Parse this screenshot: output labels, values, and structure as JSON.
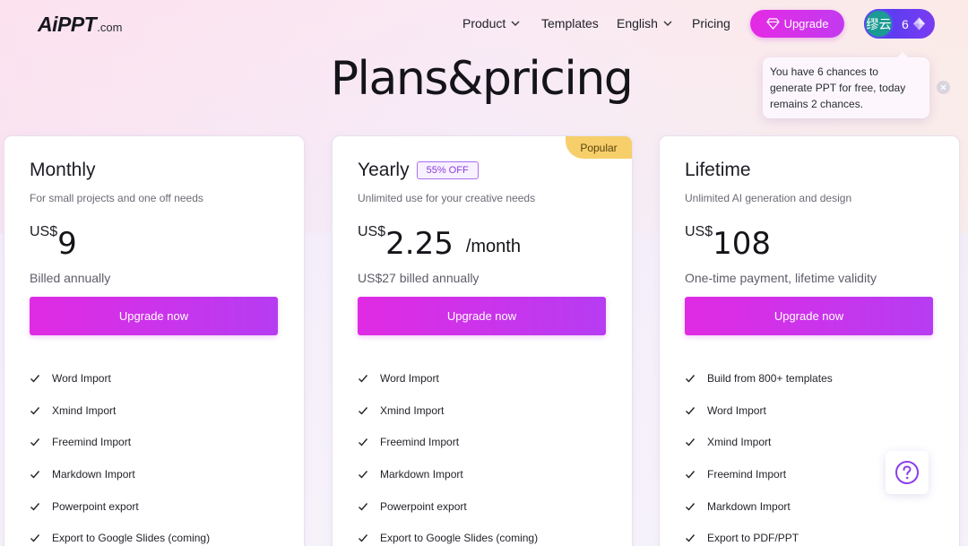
{
  "logo": {
    "main": "AiPPT",
    "sub": ".com"
  },
  "nav": {
    "product": "Product",
    "templates": "Templates",
    "language": "English",
    "pricing": "Pricing"
  },
  "header": {
    "upgrade_label": "Upgrade",
    "avatar_text": "缪云",
    "credits": "6"
  },
  "tooltip": {
    "text": "You have 6 chances to generate PPT for free, today remains 2 chances."
  },
  "page": {
    "title": "Plans&pricing"
  },
  "plans": [
    {
      "name": "Monthly",
      "description": "For small projects and one off needs",
      "currency": "US$",
      "amount": "9",
      "period": "",
      "billing": "Billed annually",
      "cta": "Upgrade now",
      "features": [
        "Word Import",
        "Xmind Import",
        "Freemind Import",
        "Markdown Import",
        "Powerpoint export",
        "Export to Google Slides (coming)"
      ]
    },
    {
      "name": "Yearly",
      "badge": "55% OFF",
      "ribbon": "Popular",
      "description": "Unlimited use for your creative needs",
      "currency": "US$",
      "amount": "2.25",
      "period": "/month",
      "billing": "US$27 billed annually",
      "cta": "Upgrade now",
      "features": [
        "Word Import",
        "Xmind Import",
        "Freemind Import",
        "Markdown Import",
        "Powerpoint export",
        "Export to Google Slides (coming)"
      ]
    },
    {
      "name": "Lifetime",
      "description": "Unlimited AI generation and design",
      "currency": "US$",
      "amount": "108",
      "period": "",
      "billing": "One-time payment, lifetime validity",
      "cta": "Upgrade now",
      "features": [
        "Build from 800+ templates",
        "Word Import",
        "Xmind Import",
        "Freemind Import",
        "Markdown Import",
        "Export to PDF/PPT"
      ]
    }
  ],
  "icons": {
    "chevron": "chevron-down-icon",
    "diamond": "diamond-icon",
    "check": "check-icon",
    "close": "close-icon",
    "help": "question-icon"
  },
  "colors": {
    "accent_magenta": "#e02be3",
    "accent_purple": "#b63cf2",
    "badge_purple": "#8c3ce6",
    "popular_yellow": "#f7cf6a",
    "avatar_teal": "#1a9b93"
  }
}
